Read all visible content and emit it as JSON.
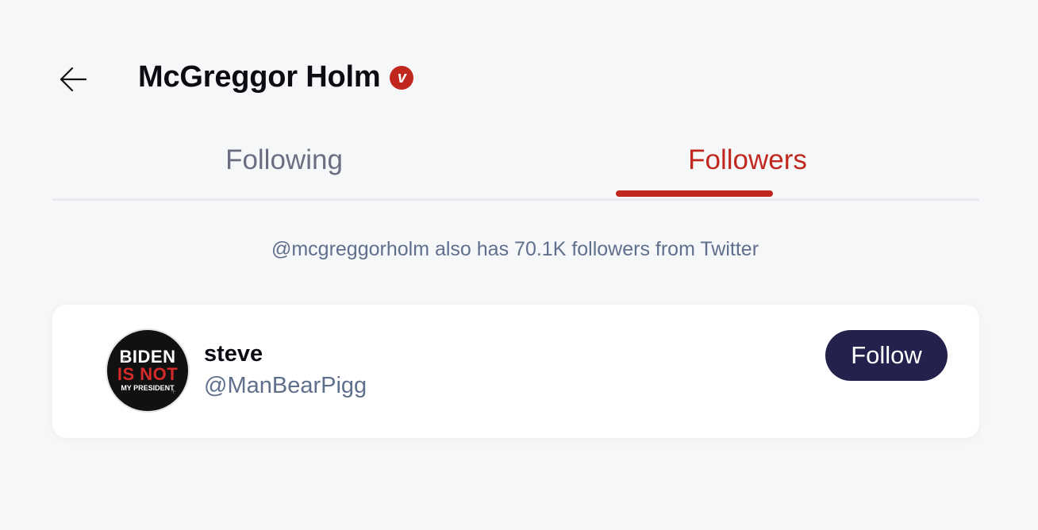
{
  "header": {
    "title": "McGreggor Holm",
    "verified_badge": "v",
    "back_icon": "arrow-left-icon"
  },
  "tabs": [
    {
      "label": "Following",
      "active": false
    },
    {
      "label": "Followers",
      "active": true
    }
  ],
  "notice": "@mcgreggorholm also has 70.1K followers from Twitter",
  "followers": [
    {
      "name": "steve",
      "handle": "@ManBearPigg",
      "avatar_text": [
        "BIDEN",
        "IS NOT",
        "MY PRESIDENT"
      ],
      "follow_label": "Follow"
    }
  ],
  "colors": {
    "accent": "#c0281f",
    "button": "#24224d",
    "background": "#f6f7f9"
  }
}
